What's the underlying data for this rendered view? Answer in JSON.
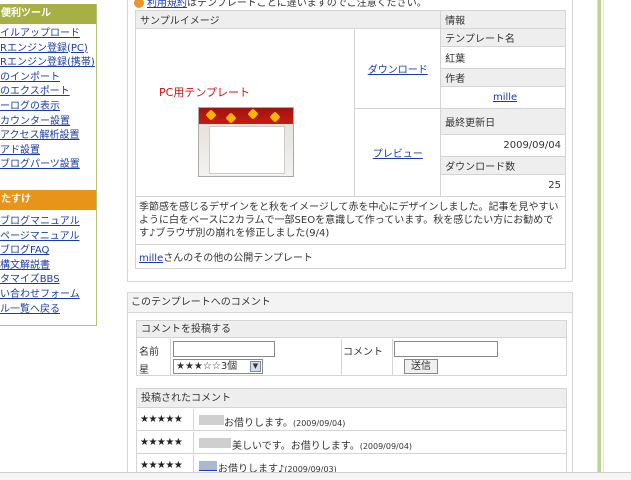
{
  "sidebar": {
    "tools_title": "便利ツール",
    "tools_items": [
      "イルアップロード",
      "Rエンジン登録(PC)",
      "Rエンジン登録(携帯)",
      "のインポート",
      "のエクスポート",
      "ーログの表示",
      "カウンター設置",
      "アクセス解析設置",
      "アド設置",
      "ブログパーツ設置"
    ],
    "help_title": "たすけ",
    "help_items": [
      "ブログマニュアル",
      "ページマニュアル",
      "ブログFAQ",
      "構文解説書",
      "タマイズBBS",
      "い合わせフォーム",
      "ル一覧へ戻る"
    ]
  },
  "top_note": {
    "link": "利用規約",
    "text": "はテンプレートごとに違いますのでご注意ください。"
  },
  "template": {
    "sample_header": "サンプルイメージ",
    "info_header": "情報",
    "pc_label": "PC用テンプレート",
    "download_link": "ダウンロード",
    "preview_link": "プレビュー",
    "fields": [
      {
        "label": "テンプレート名",
        "value": "紅葉"
      },
      {
        "label": "作者",
        "value": "mille"
      },
      {
        "label": "最終更新日",
        "value": "2009/09/04"
      },
      {
        "label": "ダウンロード数",
        "value": "25"
      }
    ],
    "description": "季節感を感じるデザインをと秋をイメージして赤を中心にデザインしました。記事を見やすいように白をベースに2カラムで一部SEOを意識して作っています。秋を感じたい方にお勧めです♪ブラウザ別の崩れを修正しました(9/4)",
    "other_author": "mille",
    "other_text": "さんのその他の公開テンプレート"
  },
  "comments": {
    "panel_title": "このテンプレートへのコメント",
    "post_title": "コメントを投稿する",
    "name_label": "名前",
    "comment_label": "コメント",
    "star_label": "星",
    "star_select_value": "★★★☆☆3個",
    "send_label": "送信",
    "posted_title": "投稿されたコメント",
    "items": [
      {
        "stars": "★★★★★",
        "text": "お借りします。",
        "date": "(2009/09/04)"
      },
      {
        "stars": "★★★★★",
        "text": "美しいです。お借りします。",
        "date": "(2009/09/04)"
      },
      {
        "stars": "★★★★★",
        "text": "お借りします♪",
        "date": "(2009/09/03)"
      }
    ]
  },
  "colors": {
    "tools_header": "#a6b045",
    "help_header": "#e8941b",
    "link": "#1a3ca8",
    "pc_label": "#cc1111"
  }
}
